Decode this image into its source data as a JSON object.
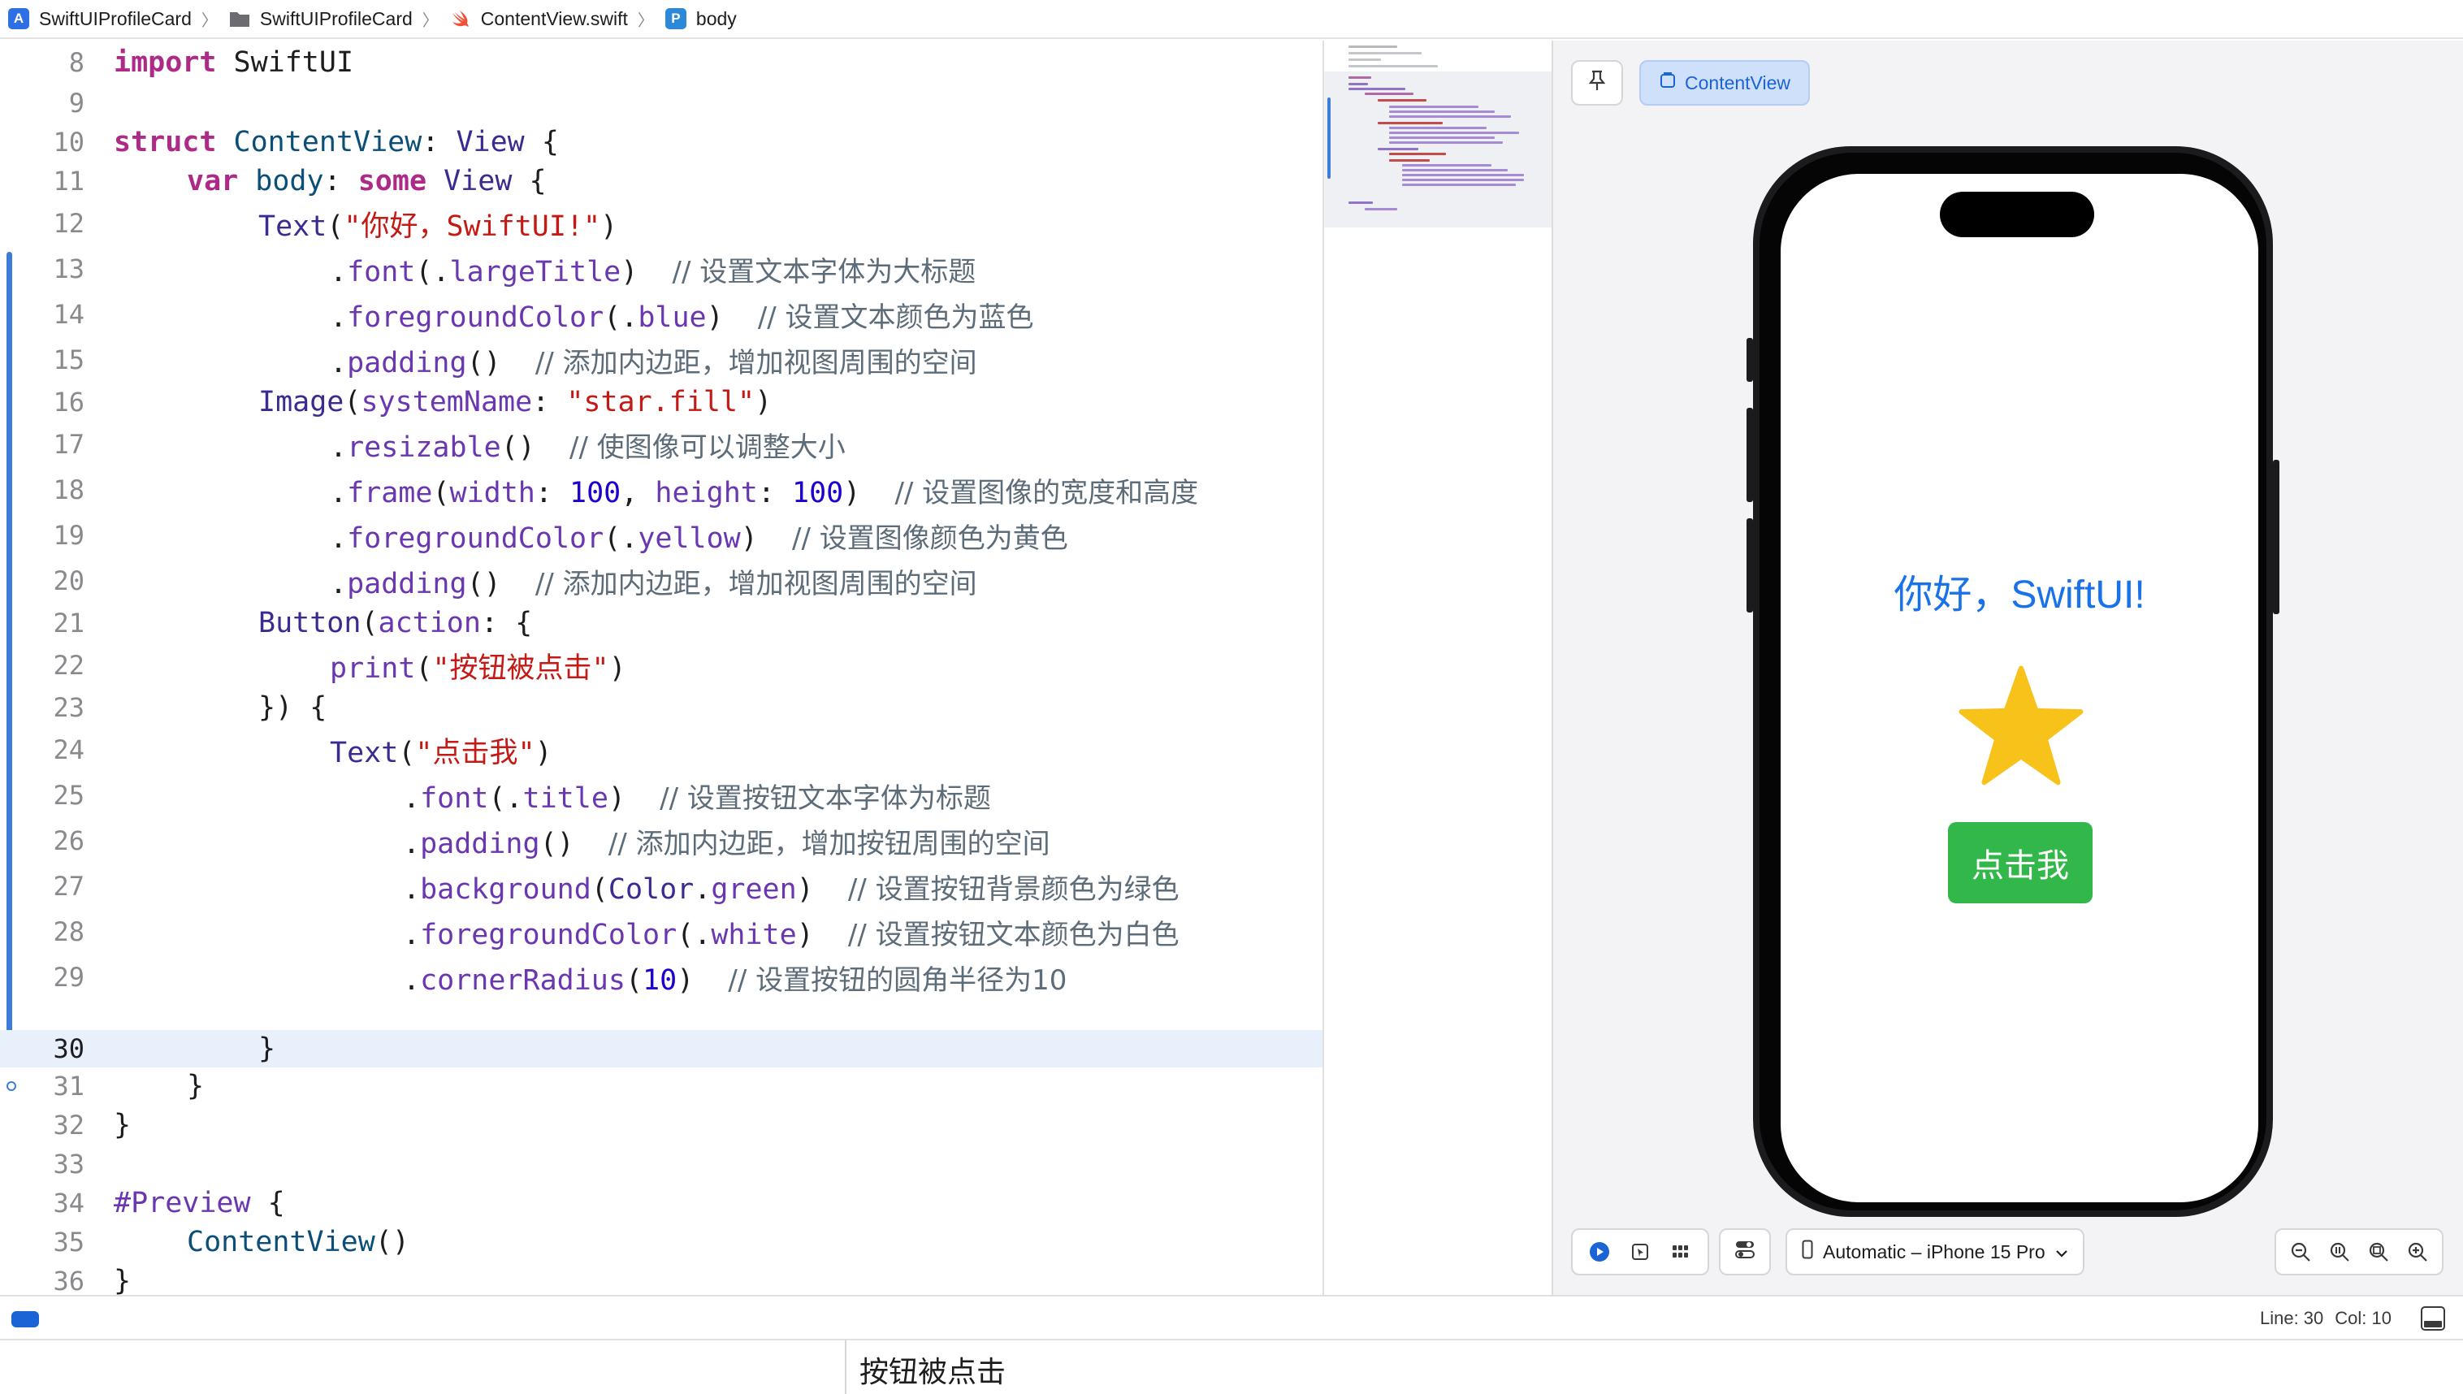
{
  "breadcrumb": {
    "items": [
      {
        "label": "SwiftUIProfileCard",
        "icon": "app-icon"
      },
      {
        "label": "SwiftUIProfileCard",
        "icon": "folder-icon"
      },
      {
        "label": "ContentView.swift",
        "icon": "swift-file-icon"
      },
      {
        "label": "body",
        "icon": "property-icon"
      }
    ]
  },
  "editor": {
    "current_line": 30,
    "lines": [
      {
        "n": "8"
      },
      {
        "n": "9"
      },
      {
        "n": "10"
      },
      {
        "n": "11"
      },
      {
        "n": "12"
      },
      {
        "n": "13"
      },
      {
        "n": "14"
      },
      {
        "n": "15"
      },
      {
        "n": "16"
      },
      {
        "n": "17"
      },
      {
        "n": "18"
      },
      {
        "n": "19"
      },
      {
        "n": "20"
      },
      {
        "n": "21"
      },
      {
        "n": "22"
      },
      {
        "n": "23"
      },
      {
        "n": "24"
      },
      {
        "n": "25"
      },
      {
        "n": "26"
      },
      {
        "n": "27"
      },
      {
        "n": "28"
      },
      {
        "n": "29"
      },
      {
        "n": "30"
      },
      {
        "n": "31"
      },
      {
        "n": "32"
      },
      {
        "n": "33"
      },
      {
        "n": "34"
      },
      {
        "n": "35"
      },
      {
        "n": "36"
      }
    ],
    "tokens": {
      "l8": [
        "import",
        " SwiftUI"
      ],
      "l10": [
        "struct",
        " ContentView",
        ": ",
        "View",
        " {"
      ],
      "l11": [
        "var",
        " body",
        ": ",
        "some",
        " View",
        " {"
      ],
      "l12": [
        "Text",
        "(",
        "\"你好，SwiftUI!\"",
        ")"
      ],
      "l13": [
        ".",
        "font",
        "(.",
        "largeTitle",
        ")",
        "// 设置文本字体为大标题"
      ],
      "l14": [
        ".",
        "foregroundColor",
        "(.",
        "blue",
        ")",
        "// 设置文本颜色为蓝色"
      ],
      "l15": [
        ".",
        "padding",
        "()",
        "// 添加内边距，增加视图周围的空间"
      ],
      "l16": [
        "Image",
        "(",
        "systemName",
        ": ",
        "\"star.fill\"",
        ")"
      ],
      "l17": [
        ".",
        "resizable",
        "()",
        "// 使图像可以调整大小"
      ],
      "l18": [
        ".",
        "frame",
        "(",
        "width",
        ": ",
        "100",
        ", ",
        "height",
        ": ",
        "100",
        ")",
        "// 设置图像的宽度和高度"
      ],
      "l19": [
        ".",
        "foregroundColor",
        "(.",
        "yellow",
        ")",
        "// 设置图像颜色为黄色"
      ],
      "l20": [
        ".",
        "padding",
        "()",
        "// 添加内边距，增加视图周围的空间"
      ],
      "l21": [
        "Button",
        "(",
        "action",
        ": {"
      ],
      "l22": [
        "print",
        "(",
        "\"按钮被点击\"",
        ")"
      ],
      "l23": [
        "}) {"
      ],
      "l24": [
        "Text",
        "(",
        "\"点击我\"",
        ")"
      ],
      "l25": [
        ".",
        "font",
        "(.",
        "title",
        ")",
        "// 设置按钮文本字体为标题"
      ],
      "l26": [
        ".",
        "padding",
        "()",
        "// 添加内边距，增加按钮周围的空间"
      ],
      "l27": [
        ".",
        "background",
        "(",
        "Color",
        ".",
        "green",
        ")",
        "// 设置按钮背景颜色为绿色"
      ],
      "l28": [
        ".",
        "foregroundColor",
        "(.",
        "white",
        ")",
        "// 设置按钮文本颜色为白色"
      ],
      "l29": [
        ".",
        "cornerRadius",
        "(",
        "10",
        ")",
        "// 设置按钮的圆角半径为10"
      ],
      "l30": [
        "}"
      ],
      "l31": [
        "}"
      ],
      "l32": [
        "}"
      ],
      "l34": [
        "#Preview",
        " {"
      ],
      "l35": [
        "ContentView",
        "()"
      ],
      "l36": [
        "}"
      ]
    }
  },
  "canvas": {
    "preview_tab_label": "ContentView",
    "device_label": "Automatic – iPhone 15 Pro",
    "preview": {
      "greeting": "你好，SwiftUI!",
      "button_label": "点击我",
      "greeting_color": "#1a72e8",
      "star_color": "#f7c21a",
      "button_color": "#32b84a"
    }
  },
  "status": {
    "line": "Line: 30",
    "col": "Col: 10"
  },
  "console": {
    "output": "按钮被点击"
  },
  "colors": {
    "accent": "#1a64d6",
    "keyword": "#ad2b87",
    "string": "#c41a16",
    "number": "#1c00cf",
    "comment": "#5d6c79"
  }
}
